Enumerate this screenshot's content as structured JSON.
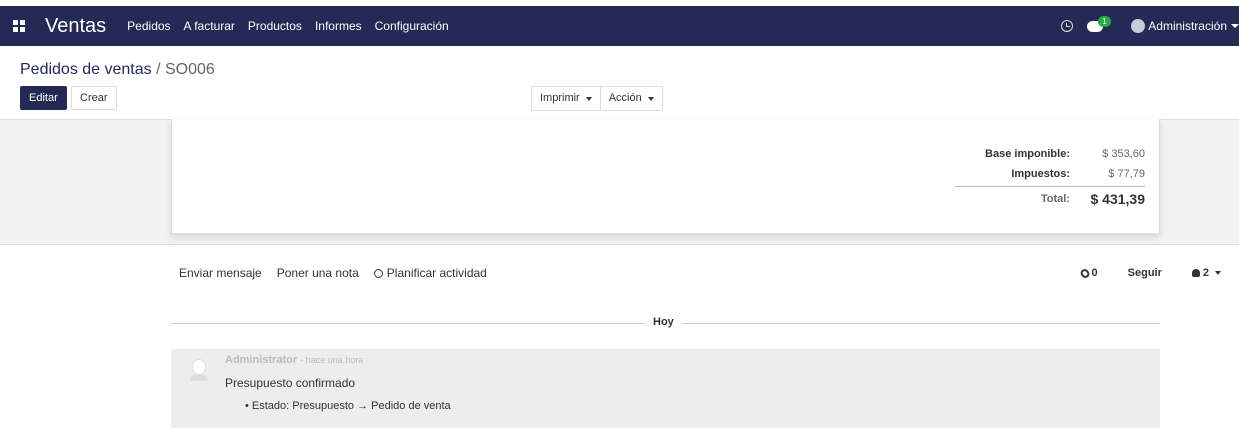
{
  "navbar": {
    "app_name": "Ventas",
    "menu": [
      "Pedidos",
      "A facturar",
      "Productos",
      "Informes",
      "Configuración"
    ],
    "chat_badge": "1",
    "user": "Administración",
    "bg_color": "#242a56"
  },
  "breadcrumb": {
    "parent": "Pedidos de ventas",
    "separator": " / ",
    "current": "SO006"
  },
  "actions": {
    "edit": "Editar",
    "create": "Crear",
    "print": "Imprimir",
    "action": "Acción"
  },
  "totals": {
    "base_label": "Base imponible:",
    "base_value": "$ 353,60",
    "tax_label": "Impuestos:",
    "tax_value": "$ 77,79",
    "total_label": "Total:",
    "total_value": "$ 431,39"
  },
  "chatter": {
    "send_message": "Enviar mensaje",
    "log_note": "Poner una nota",
    "schedule": "Planificar actividad",
    "attachments": "0",
    "follow": "Seguir",
    "followers": "2",
    "day": "Hoy",
    "author": "Administrator",
    "time": "- hace una hora",
    "body": "Presupuesto confirmado",
    "tracking": "• Estado: Presupuesto → Pedido de venta"
  }
}
